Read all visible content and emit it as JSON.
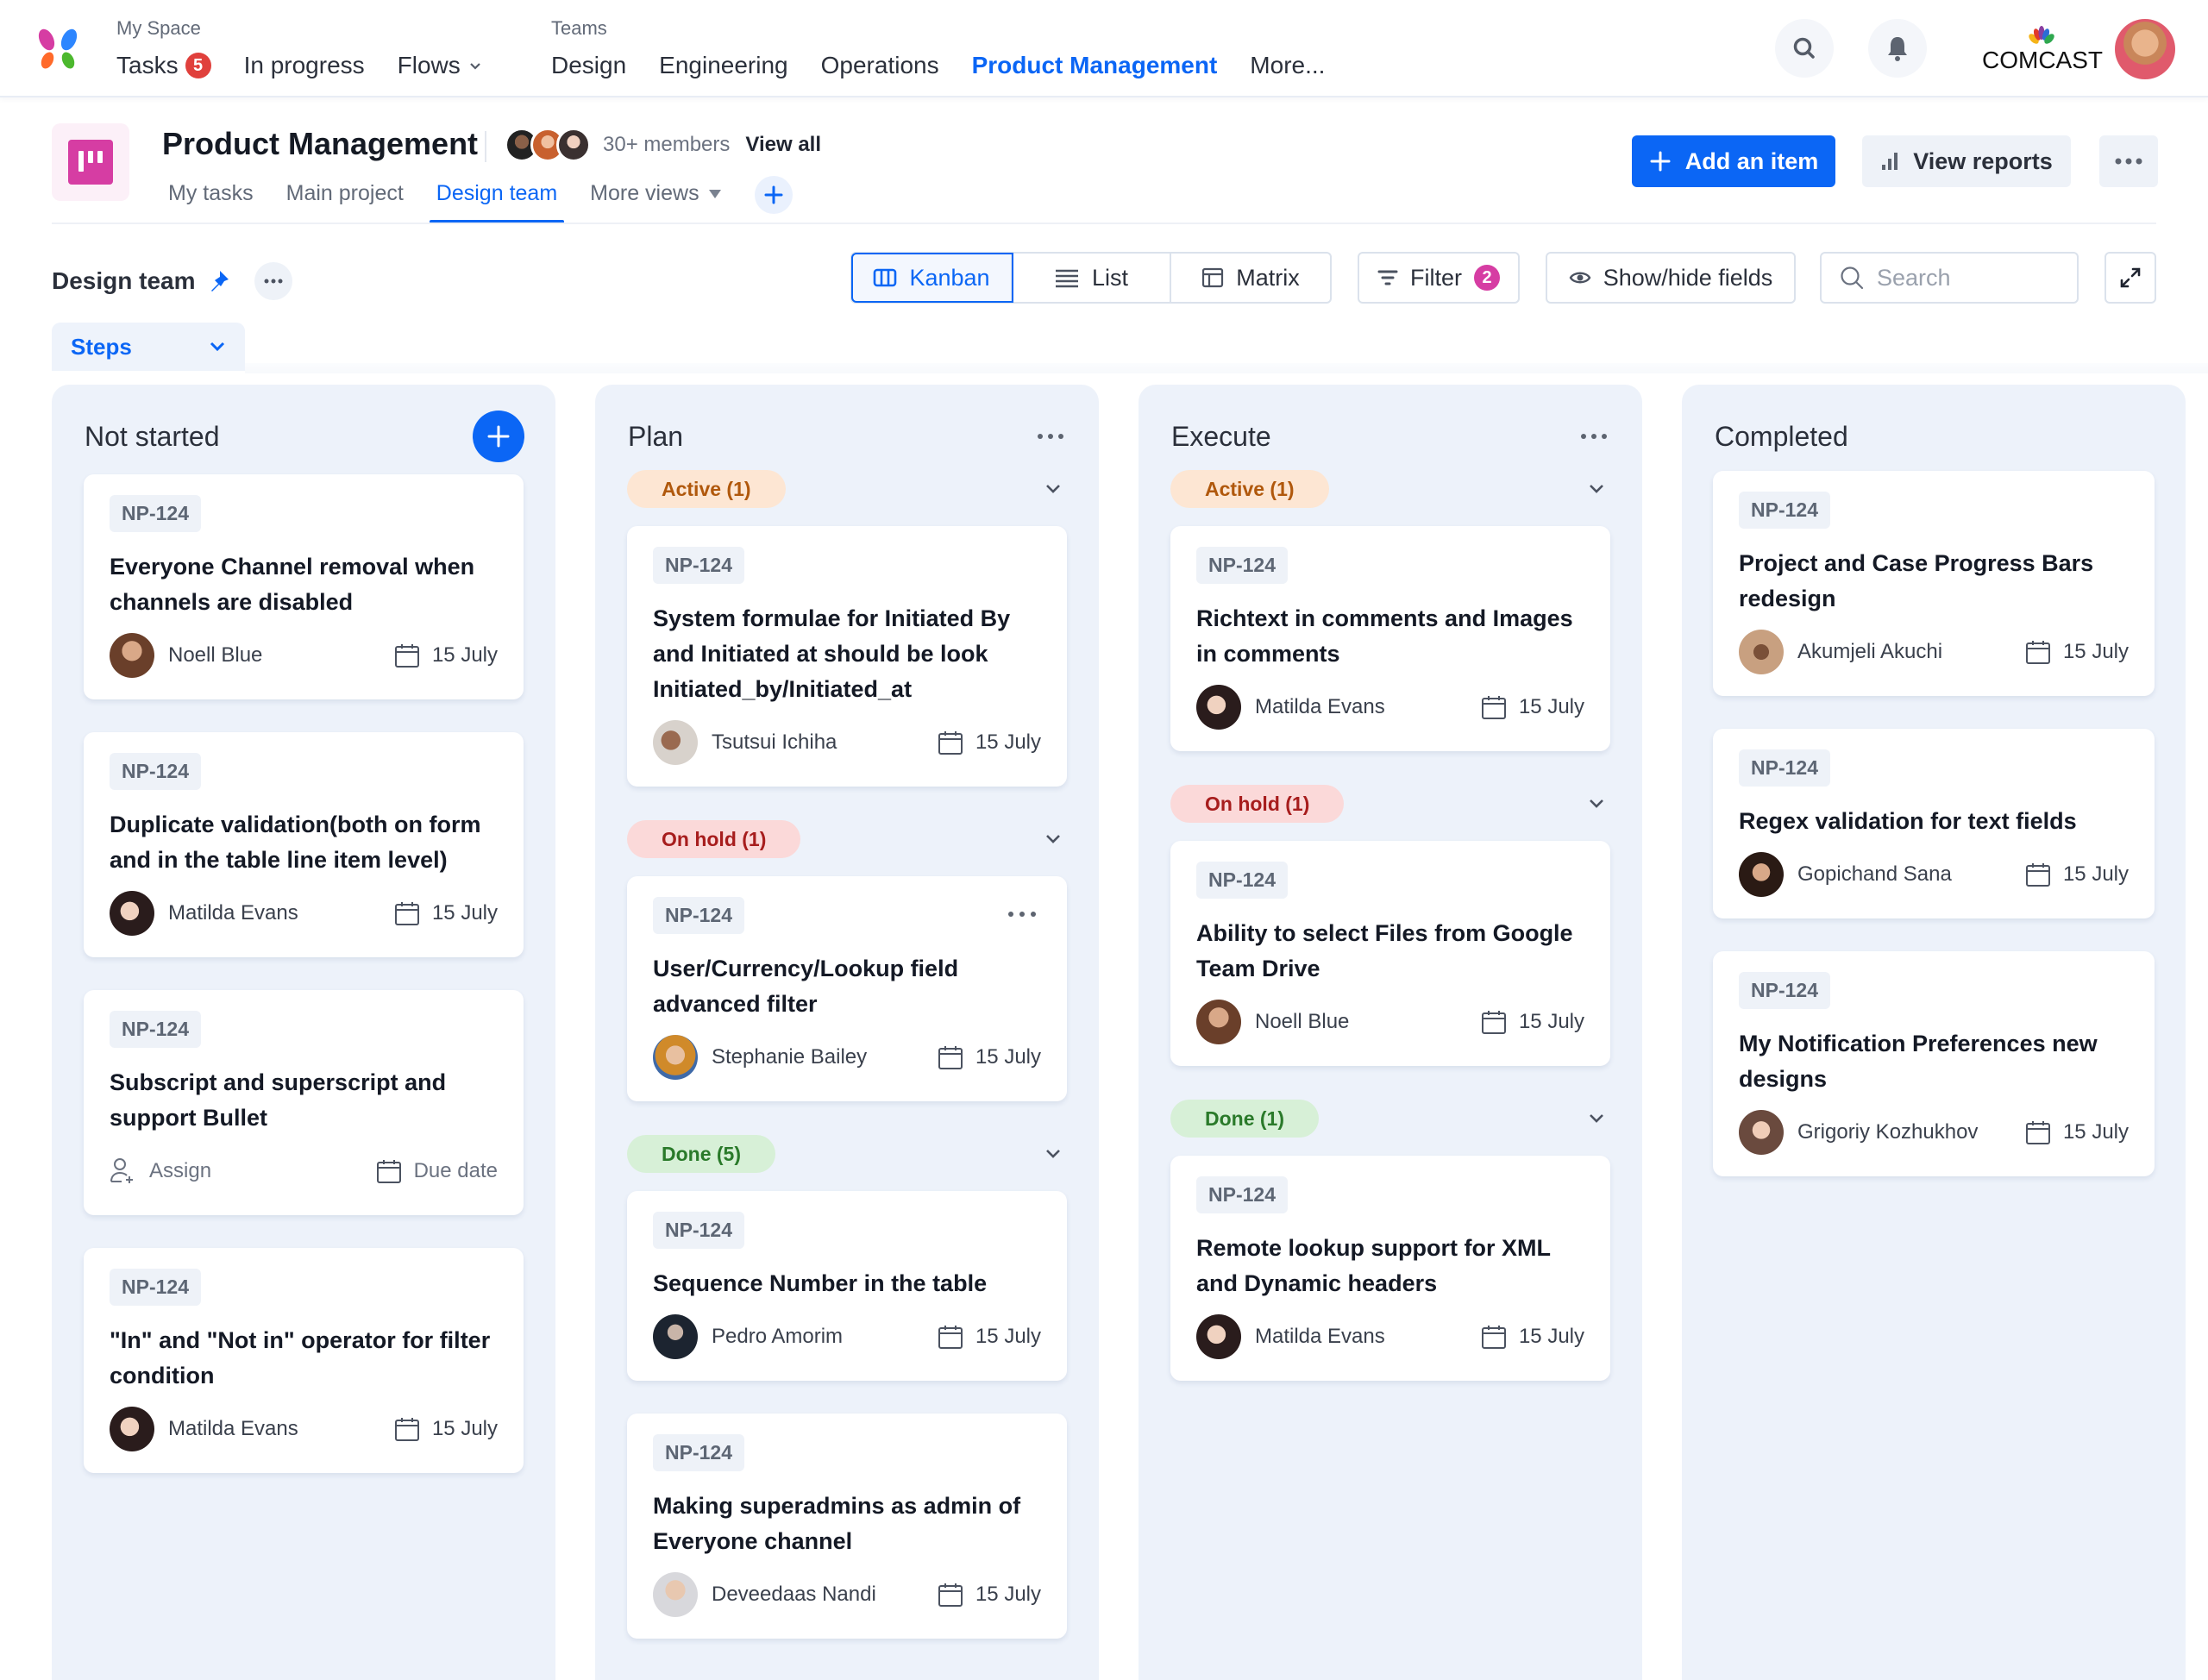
{
  "topnav": {
    "my_space": {
      "label": "My Space",
      "items": [
        {
          "label": "Tasks",
          "badge": "5"
        },
        {
          "label": "In progress"
        },
        {
          "label": "Flows",
          "has_dropdown": true
        }
      ]
    },
    "teams": {
      "label": "Teams",
      "items": [
        {
          "label": "Design"
        },
        {
          "label": "Engineering"
        },
        {
          "label": "Operations"
        },
        {
          "label": "Product Management",
          "active": true
        },
        {
          "label": "More..."
        }
      ]
    },
    "icons": [
      "search-icon",
      "bell-icon"
    ],
    "brand": "COMCAST"
  },
  "project": {
    "title": "Product Management",
    "members_text": "30+ members",
    "view_all": "View all",
    "tabs": [
      {
        "label": "My tasks"
      },
      {
        "label": "Main project"
      },
      {
        "label": "Design team",
        "active": true
      },
      {
        "label": "More views",
        "has_dropdown": true
      }
    ],
    "add_item": "Add an item",
    "view_reports": "View reports"
  },
  "toolbar": {
    "view_name": "Design team",
    "views": [
      {
        "label": "Kanban",
        "icon": "kanban-icon",
        "active": true
      },
      {
        "label": "List",
        "icon": "list-icon"
      },
      {
        "label": "Matrix",
        "icon": "matrix-icon"
      }
    ],
    "filter_label": "Filter",
    "filter_count": "2",
    "show_hide": "Show/hide fields",
    "search_placeholder": "Search",
    "group_by": "Steps"
  },
  "colors": {
    "accent": "#0b66f5",
    "active_bg": "#fde6d3",
    "onhold_bg": "#fbd9d9",
    "done_bg": "#d7f0d7",
    "column_bg": "#edf2fa"
  },
  "columns": [
    {
      "title": "Not started",
      "cards": [
        {
          "id": "NP-124",
          "title": "Everyone Channel removal when channels are disabled",
          "assignee": "Noell Blue",
          "due": "15 July"
        },
        {
          "id": "NP-124",
          "title": "Duplicate validation(both on form and in the table line item level)",
          "assignee": "Matilda Evans",
          "due": "15 July"
        },
        {
          "id": "NP-124",
          "title": "Subscript and superscript  and support Bullet",
          "assignee": "Assign",
          "due": "Due date",
          "unassigned": true
        },
        {
          "id": "NP-124",
          "title": "\"In\" and \"Not in\" operator for filter condition",
          "assignee": "Matilda Evans",
          "due": "15 July"
        }
      ]
    },
    {
      "title": "Plan",
      "groups": [
        {
          "label": "Active (1)",
          "cards": [
            {
              "id": "NP-124",
              "title": "System formulae for Initiated By and Initiated at should be look Initiated_by/Initiated_at",
              "assignee": "Tsutsui Ichiha",
              "due": "15 July"
            }
          ]
        },
        {
          "label": "On hold (1)",
          "cards": [
            {
              "id": "NP-124",
              "title": "User/Currency/Lookup field advanced filter",
              "assignee": "Stephanie Bailey",
              "due": "15 July"
            }
          ]
        },
        {
          "label": "Done (5)",
          "cards": [
            {
              "id": "NP-124",
              "title": "Sequence Number in the table",
              "assignee": "Pedro Amorim",
              "due": "15 July"
            },
            {
              "id": "NP-124",
              "title": "Making superadmins as admin of Everyone channel",
              "assignee": "Deveedaas Nandi",
              "due": "15 July"
            }
          ]
        }
      ]
    },
    {
      "title": "Execute",
      "groups": [
        {
          "label": "Active (1)",
          "cards": [
            {
              "id": "NP-124",
              "title": "Richtext in comments and Images in comments",
              "assignee": "Matilda Evans",
              "due": "15 July"
            }
          ]
        },
        {
          "label": "On hold (1)",
          "cards": [
            {
              "id": "NP-124",
              "title": "Ability to select Files from Google Team Drive",
              "assignee": "Noell Blue",
              "due": "15 July"
            }
          ]
        },
        {
          "label": "Done (1)",
          "cards": [
            {
              "id": "NP-124",
              "title": "Remote lookup support for XML and Dynamic headers",
              "assignee": "Matilda Evans",
              "due": "15 July"
            }
          ]
        }
      ]
    },
    {
      "title": "Completed",
      "cards": [
        {
          "id": "NP-124",
          "title": "Project and Case Progress Bars redesign",
          "assignee": "Akumjeli Akuchi",
          "due": "15 July"
        },
        {
          "id": "NP-124",
          "title": "Regex validation for text fields",
          "assignee": "Gopichand Sana",
          "due": "15 July"
        },
        {
          "id": "NP-124",
          "title": "My Notification Preferences new designs",
          "assignee": "Grigoriy Kozhukhov",
          "due": "15 July"
        }
      ]
    }
  ]
}
